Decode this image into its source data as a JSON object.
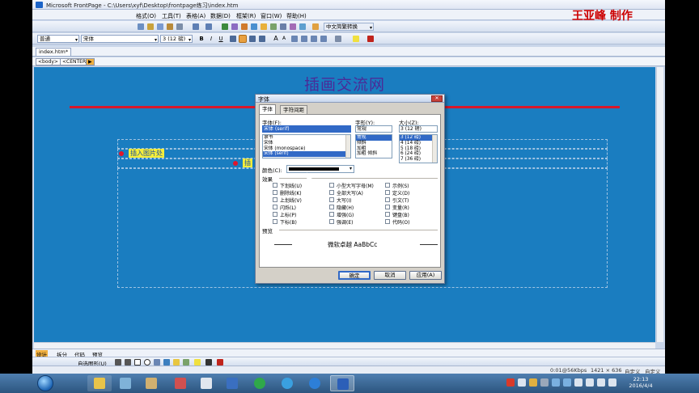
{
  "app": {
    "title": "Microsoft FrontPage - C:\\Users\\xyf\\Desktop\\frontpage练习\\index.htm"
  },
  "watermark": "王亚峰 制作",
  "menu": [
    "格式(O)",
    "工具(T)",
    "表格(A)",
    "数据(D)",
    "框架(R)",
    "窗口(W)",
    "帮助(H)"
  ],
  "toolbar": {
    "translate_label": "中文简繁转换"
  },
  "format_toolbar": {
    "style": "普通",
    "font": "宋体",
    "size": "3 (12 磅)",
    "bold": "B",
    "italic": "I",
    "underline": "U",
    "grow": "A",
    "shrink": "A"
  },
  "doc_tab": "index.htm*",
  "quick_tags": [
    "<body>",
    "<CENTER>"
  ],
  "page": {
    "title": "插画交流网",
    "label1": "插入图片处",
    "label2": "插"
  },
  "view_tabs": [
    "设计",
    "拆分",
    "代码",
    "预览"
  ],
  "draw_bar": {
    "autoshapes": "自选图形(U)"
  },
  "status": {
    "speed": "0:01@56Kbps",
    "resolution": "1421 × 636",
    "custom1": "自定义",
    "custom2": "自定义"
  },
  "clock": {
    "time": "22:13",
    "date": "2016/4/4"
  },
  "dialog": {
    "title": "字体",
    "tabs": [
      "字体",
      "字符间距"
    ],
    "font_label": "字体(F):",
    "font_value": "宋体 (serif)",
    "font_list": [
      "隶书",
      "宋体",
      "宋体 (monospace)",
      "宋体 (serif)"
    ],
    "style_label": "字形(Y):",
    "style_value": "常规",
    "style_list": [
      "常规",
      "倾斜",
      "加粗",
      "加粗 倾斜"
    ],
    "size_label": "大小(Z):",
    "size_value": "3 (12 磅)",
    "size_list": [
      "3 (12 磅)",
      "4 (14 磅)",
      "5 (18 磅)",
      "6 (24 磅)",
      "7 (36 磅)"
    ],
    "color_label": "颜色(C):",
    "color_value": "#000000",
    "effects_label": "效果",
    "effects": [
      [
        "下划线(U)",
        "小型大写字母(M)",
        "示例(S)"
      ],
      [
        "删除线(K)",
        "全部大写(A)",
        "定义(D)"
      ],
      [
        "上划线(V)",
        "大写(I)",
        "引文(T)"
      ],
      [
        "闪烁(L)",
        "隐藏(H)",
        "变量(R)"
      ],
      [
        "上标(P)",
        "增强(G)",
        "键盘(B)"
      ],
      [
        "下标(B)",
        "强调(E)",
        "代码(O)"
      ]
    ],
    "preview_label": "预览",
    "preview_text": "微软卓越 AaBbCc",
    "ok": "确定",
    "cancel": "取消",
    "apply": "应用(A)"
  }
}
